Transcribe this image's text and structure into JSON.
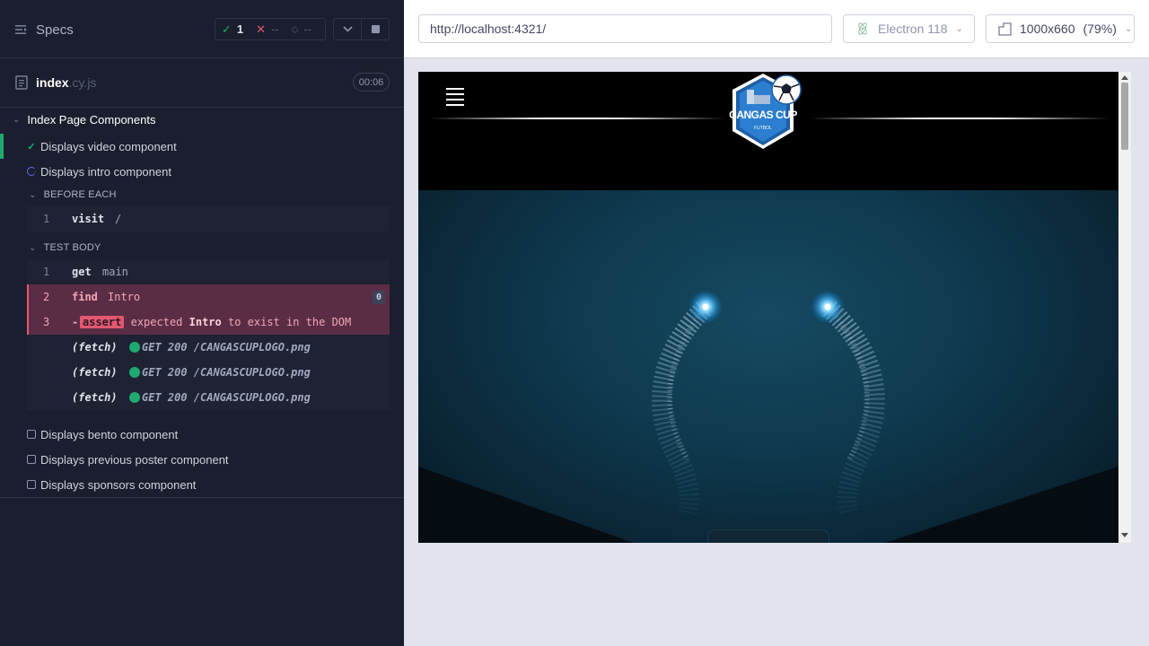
{
  "reporter": {
    "specs_label": "Specs",
    "stats": {
      "passed": "1",
      "failed": "--",
      "pending": "--"
    },
    "file": {
      "name": "index",
      "ext": ".cy.js",
      "duration": "00:06"
    },
    "suite": {
      "title": "Index Page Components",
      "tests": [
        {
          "label": "Displays video component",
          "state": "passed"
        },
        {
          "label": "Displays intro component",
          "state": "running"
        },
        {
          "label": "Displays bento component",
          "state": "pending"
        },
        {
          "label": "Displays previous poster component",
          "state": "pending"
        },
        {
          "label": "Displays sponsors component",
          "state": "pending"
        }
      ],
      "before_each": {
        "header": "BEFORE EACH",
        "commands": [
          {
            "index": "1",
            "name": "visit",
            "message": "/"
          }
        ]
      },
      "test_body": {
        "header": "TEST BODY",
        "commands": [
          {
            "index": "1",
            "name": "get",
            "message": "main"
          },
          {
            "index": "2",
            "name": "find",
            "message": "Intro",
            "badge": "0"
          },
          {
            "index": "3",
            "name": "-",
            "assert": "assert",
            "expected": "expected",
            "subject": "Intro",
            "rest": "to exist in the DOM"
          },
          {
            "name": "(fetch)",
            "message": "GET 200 /CANGASCUPLOGO.png"
          },
          {
            "name": "(fetch)",
            "message": "GET 200 /CANGASCUPLOGO.png"
          },
          {
            "name": "(fetch)",
            "message": "GET 200 /CANGASCUPLOGO.png"
          }
        ]
      }
    }
  },
  "aut": {
    "url": "http://localhost:4321/",
    "browser": "Electron 118",
    "viewport": "1000x660",
    "scale": "(79%)",
    "site": {
      "logo_text": "CANGAS CUP",
      "logo_sub": "FUTBOL"
    }
  },
  "colors": {
    "pass": "#1fa971",
    "fail": "#e45770",
    "running": "#6470f3",
    "panel_bg": "#1b1e2e"
  }
}
